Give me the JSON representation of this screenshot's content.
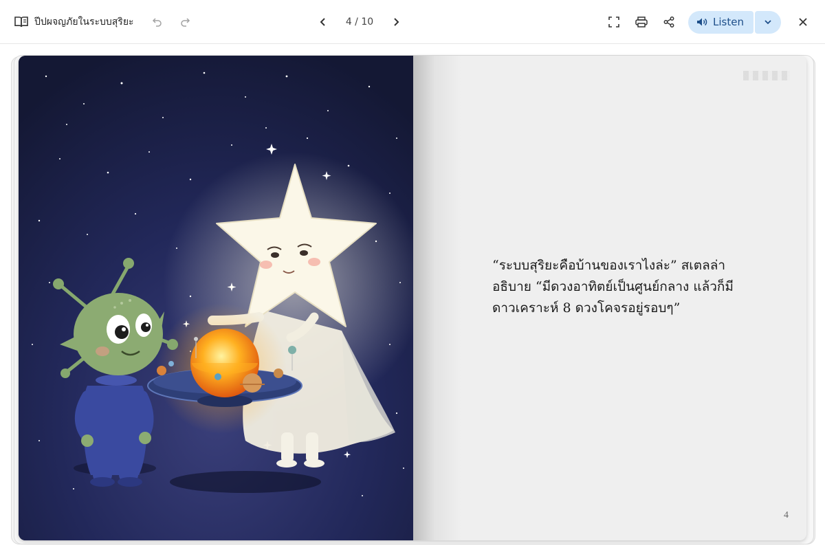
{
  "toolbar": {
    "book_title": "ปีปผจญภัยในระบบสุริยะ",
    "page_indicator": "4 / 10",
    "listen_label": "Listen"
  },
  "icons": {
    "book": "book-open-icon",
    "undo": "undo-icon",
    "redo": "redo-icon",
    "prev": "chevron-left-icon",
    "next": "chevron-right-icon",
    "fullscreen": "fullscreen-icon",
    "print": "printer-icon",
    "share": "share-icon",
    "speaker": "speaker-icon",
    "dropdown": "chevron-down-icon",
    "close": "close-icon"
  },
  "colors": {
    "listen_bg": "#d3e8fb",
    "listen_text": "#1d4e89",
    "night_sky": "#1a1f45"
  },
  "page": {
    "story_text": "“ระบบสุริยะคือบ้านของเราไงล่ะ” สเตลล่าอธิบาย “มีดวงอาทิตย์เป็นศูนย์กลาง แล้วก็มีดาวเคราะห์ 8 ดวงโคจรอยู่รอบๆ”",
    "page_number": "4"
  }
}
